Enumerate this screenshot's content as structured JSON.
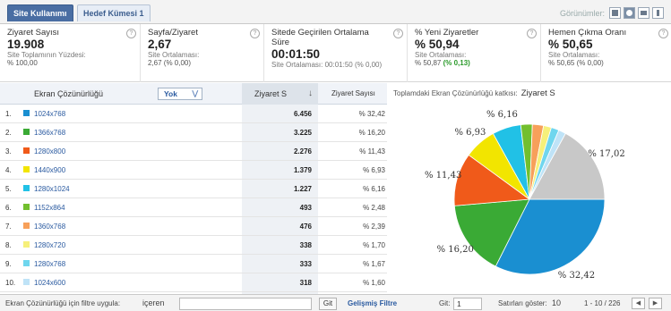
{
  "tabs": {
    "items": [
      {
        "label": "Site Kullanımı",
        "active": true
      },
      {
        "label": "Hedef Kümesi 1",
        "active": false
      }
    ],
    "views_label": "Görünümler:",
    "view_icons": [
      "table-view-icon",
      "pie-view-icon",
      "performance-view-icon",
      "comparison-view-icon"
    ]
  },
  "metrics": [
    {
      "title": "Ziyaret Sayısı",
      "value": "19.908",
      "sub1": "Site Toplamının Yüzdesi:",
      "sub2": "% 100,00",
      "sub2_extra": ""
    },
    {
      "title": "Sayfa/Ziyaret",
      "value": "2,67",
      "sub1": "Site Ortalaması:",
      "sub2": "2,67 (% 0,00)",
      "sub2_extra": ""
    },
    {
      "title": "Sitede Geçirilen Ortalama Süre",
      "value": "00:01:50",
      "sub1": "Site Ortalaması: 00:01:50 (% 0,00)",
      "sub2": "",
      "sub2_extra": ""
    },
    {
      "title": "% Yeni Ziyaretler",
      "value": "% 50,94",
      "sub1": "Site Ortalaması:",
      "sub2": "% 50,87 ",
      "sub2_extra": "(% 0,13)"
    },
    {
      "title": "Hemen Çıkma Oranı",
      "value": "% 50,65",
      "sub1": "Site Ortalaması:",
      "sub2": "% 50,65 (% 0,00)",
      "sub2_extra": ""
    }
  ],
  "help_glyph": "?",
  "table": {
    "col_resolution": "Ekran Çözünürlüğü",
    "secondary_dim": "Yok",
    "col_visits": "Ziyaret S",
    "sort_arrow": "↓",
    "col_visits_pct": "Ziyaret Sayısı",
    "rows": [
      {
        "n": "1.",
        "res": "1024x768",
        "visits": "6.456",
        "pct": "% 32,42",
        "color": "#1a8fd1"
      },
      {
        "n": "2.",
        "res": "1366x768",
        "visits": "3.225",
        "pct": "% 16,20",
        "color": "#3aaa35"
      },
      {
        "n": "3.",
        "res": "1280x800",
        "visits": "2.276",
        "pct": "% 11,43",
        "color": "#f05a1a"
      },
      {
        "n": "4.",
        "res": "1440x900",
        "visits": "1.379",
        "pct": "% 6,93",
        "color": "#f2e500"
      },
      {
        "n": "5.",
        "res": "1280x1024",
        "visits": "1.227",
        "pct": "% 6,16",
        "color": "#21c1e6"
      },
      {
        "n": "6.",
        "res": "1152x864",
        "visits": "493",
        "pct": "% 2,48",
        "color": "#72bf2e"
      },
      {
        "n": "7.",
        "res": "1360x768",
        "visits": "476",
        "pct": "% 2,39",
        "color": "#f7a05a"
      },
      {
        "n": "8.",
        "res": "1280x720",
        "visits": "338",
        "pct": "% 1,70",
        "color": "#f6f07a"
      },
      {
        "n": "9.",
        "res": "1280x768",
        "visits": "333",
        "pct": "% 1,67",
        "color": "#6fd6ee"
      },
      {
        "n": "10.",
        "res": "1024x600",
        "visits": "318",
        "pct": "% 1,60",
        "color": "#bfe3f7"
      }
    ]
  },
  "chart_head": {
    "caption": "Toplamdaki Ekran Çözünürlüğü katkısı:",
    "metric": "Ziyaret S"
  },
  "chart_data": {
    "type": "pie",
    "values": [
      32.42,
      16.2,
      11.43,
      6.93,
      6.16,
      2.48,
      2.39,
      1.7,
      1.67,
      1.6,
      17.02
    ],
    "colors": [
      "#1a8fd1",
      "#3aaa35",
      "#f05a1a",
      "#f2e500",
      "#21c1e6",
      "#72bf2e",
      "#f7a05a",
      "#f6f07a",
      "#6fd6ee",
      "#bfe3f7",
      "#c8c8c8"
    ],
    "data_labels": [
      "% 32,42",
      "% 16,20",
      "% 11,43",
      "% 6,93",
      "% 6,16",
      "",
      "",
      "",
      "",
      "",
      "% 17,02"
    ]
  },
  "footer": {
    "filter_label": "Ekran Çözünürlüğü için filtre uygula:",
    "filter_mode": "içeren",
    "go_label": "Git",
    "advanced_filter": "Gelişmiş Filtre",
    "goto_label": "Git:",
    "goto_value": "1",
    "rows_label": "Satırları göster:",
    "rows_value": "10",
    "range": "1 - 10 / 226",
    "prev": "◀",
    "next": "▶"
  }
}
